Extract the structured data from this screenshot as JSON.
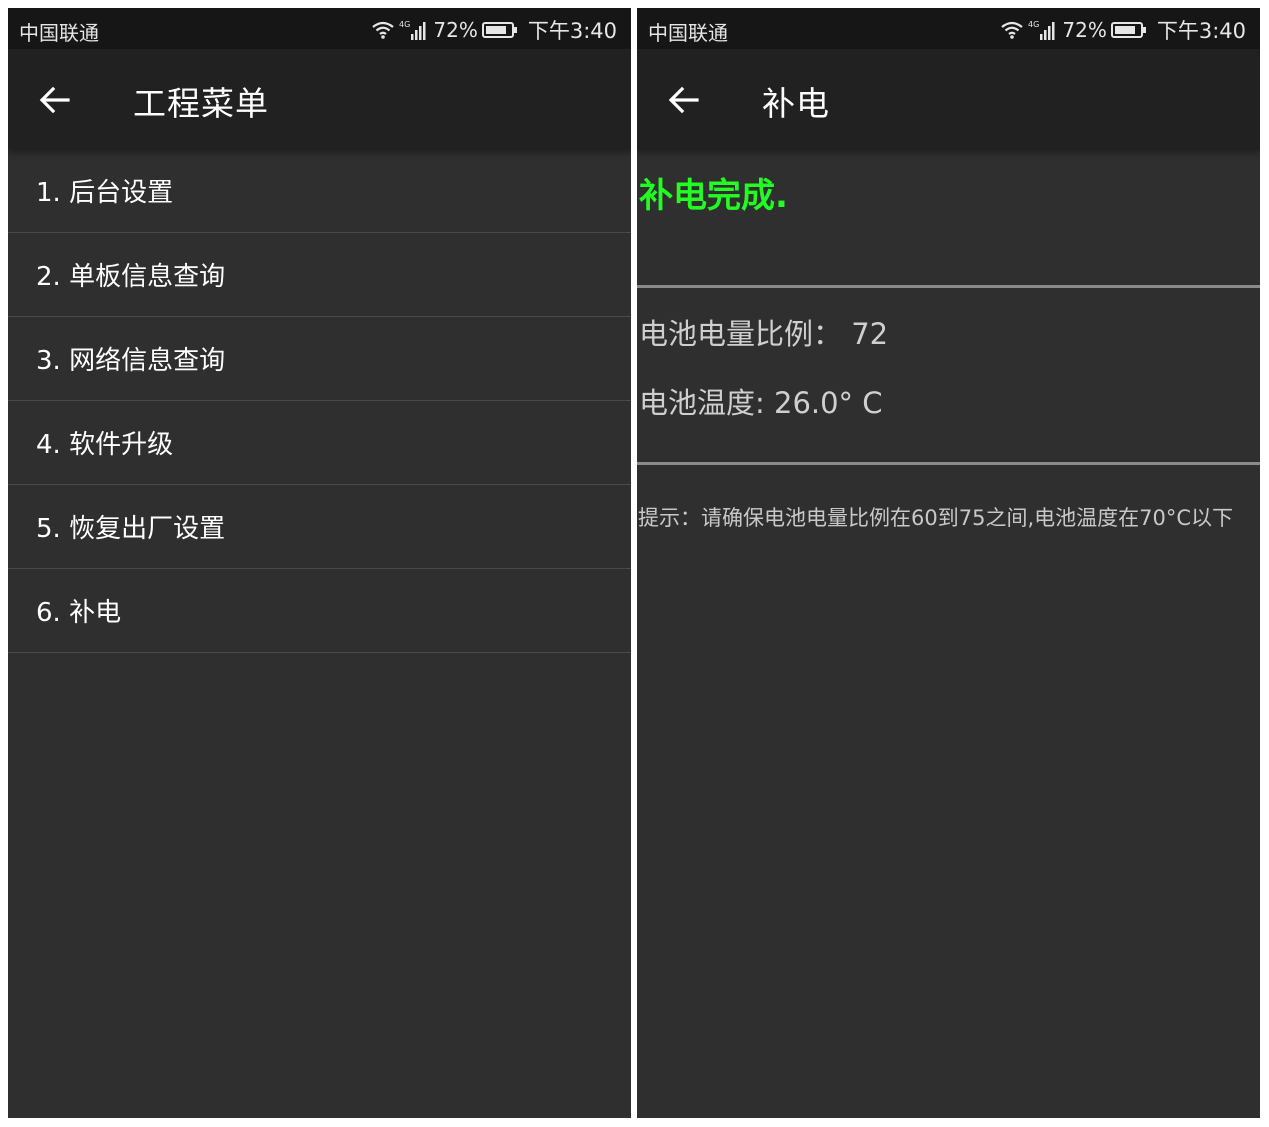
{
  "left_screen": {
    "status_bar": {
      "carrier": "中国联通",
      "network": "4G",
      "battery_percent": "72%",
      "time": "下午3:40",
      "icons": [
        "wifi-icon",
        "signal-icon",
        "battery-icon"
      ]
    },
    "toolbar": {
      "title": "工程菜单",
      "back_icon": "back-arrow-icon"
    },
    "menu_items": [
      {
        "label": "1. 后台设置"
      },
      {
        "label": "2. 单板信息查询"
      },
      {
        "label": "3. 网络信息查询"
      },
      {
        "label": "4. 软件升级"
      },
      {
        "label": "5. 恢复出厂设置"
      },
      {
        "label": "6. 补电"
      }
    ]
  },
  "right_screen": {
    "status_bar": {
      "carrier": "中国联通",
      "network": "4G",
      "battery_percent": "72%",
      "time": "下午3:40",
      "icons": [
        "wifi-icon",
        "signal-icon",
        "battery-icon"
      ]
    },
    "toolbar": {
      "title": "补电",
      "back_icon": "back-arrow-icon"
    },
    "result_text": "补电完成.",
    "battery_ratio": "电池电量比例： 72",
    "battery_temperature": "电池温度: 26.0° C",
    "hint": "提示：请确保电池电量比例在60到75之间,电池温度在70°C以下"
  },
  "colors": {
    "background": "#2f2f2f",
    "status_bar": "#161616",
    "toolbar": "#212121",
    "result_green": "#22ff22",
    "text_primary": "#ffffff",
    "text_secondary": "#cfcfcf",
    "divider": "#8a8a8a"
  }
}
